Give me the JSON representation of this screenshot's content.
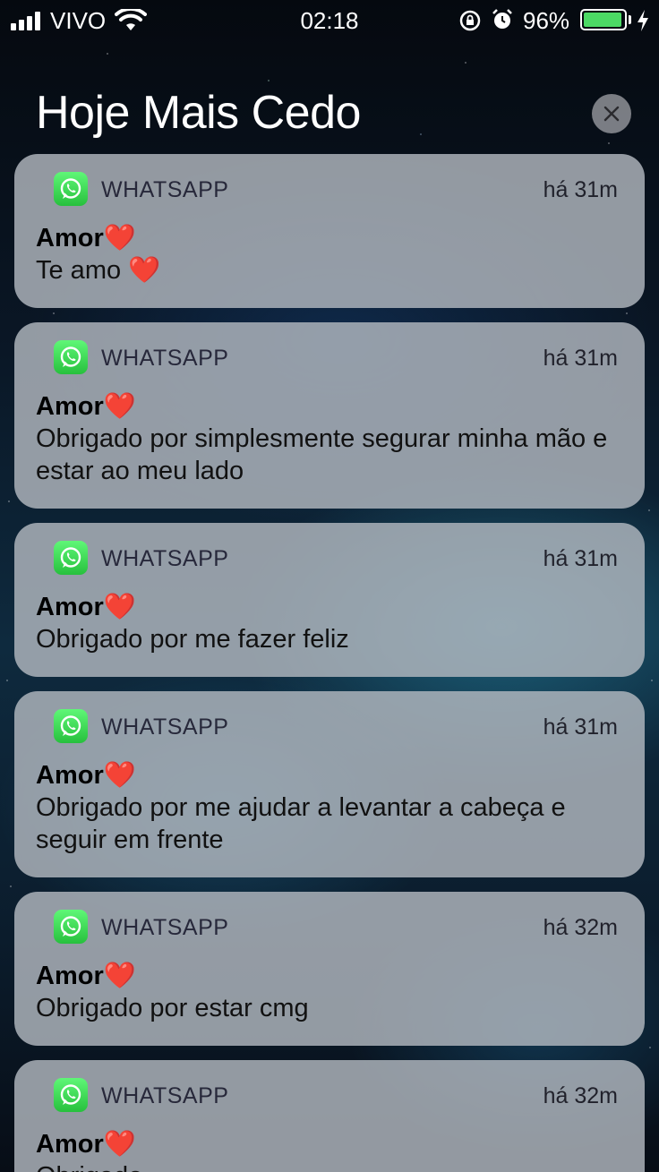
{
  "status_bar": {
    "carrier": "VIVO",
    "time": "02:18",
    "battery_percent": "96%",
    "battery_level": 0.96,
    "battery_color": "#4cd964"
  },
  "header": {
    "title": "Hoje Mais Cedo",
    "clear_icon": "close-icon"
  },
  "notifications": [
    {
      "app": "WHATSAPP",
      "time": "há 31m",
      "sender": "Amor❤️",
      "message": "Te amo ❤️"
    },
    {
      "app": "WHATSAPP",
      "time": "há 31m",
      "sender": "Amor❤️",
      "message": "Obrigado por simplesmente segurar minha mão e estar ao meu lado"
    },
    {
      "app": "WHATSAPP",
      "time": "há 31m",
      "sender": "Amor❤️",
      "message": "Obrigado por me fazer feliz"
    },
    {
      "app": "WHATSAPP",
      "time": "há 31m",
      "sender": "Amor❤️",
      "message": "Obrigado por me ajudar a levantar a cabeça e seguir em frente"
    },
    {
      "app": "WHATSAPP",
      "time": "há 32m",
      "sender": "Amor❤️",
      "message": "Obrigado por estar cmg"
    },
    {
      "app": "WHATSAPP",
      "time": "há 32m",
      "sender": "Amor❤️",
      "message": "Obrigado"
    }
  ],
  "colors": {
    "whatsapp_green": "#25d366",
    "card_background": "#b2b8c0"
  }
}
